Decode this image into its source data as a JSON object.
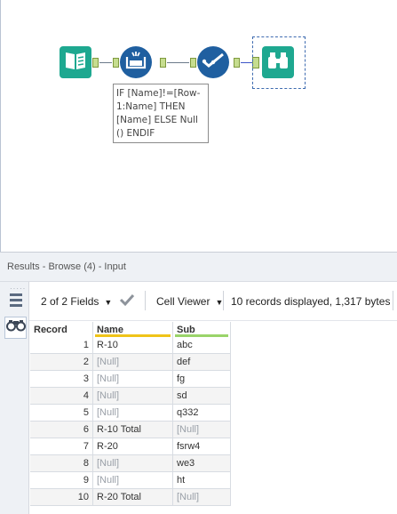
{
  "workflow": {
    "annotation": "IF [Name]!=[Row-\n1:Name] THEN\n[Name] ELSE Null\n() ENDIF",
    "tools": [
      {
        "name": "input-tool",
        "icon": "book-icon",
        "color": "#1ea890"
      },
      {
        "name": "multi-row-formula-tool",
        "icon": "formula-icon",
        "color": "#1f5fa0"
      },
      {
        "name": "select-tool",
        "icon": "checkmark-icon",
        "color": "#1f5fa0"
      },
      {
        "name": "browse-tool",
        "icon": "binoculars-icon",
        "color": "#1ea890"
      }
    ]
  },
  "results": {
    "title": "Results - Browse (4) - Input",
    "toolbar": {
      "fields_label": "2 of 2 Fields",
      "viewer_label": "Cell Viewer",
      "records_info": "10 records displayed, 1,317 bytes"
    },
    "columns": [
      "Record",
      "Name",
      "Sub"
    ],
    "rows": [
      {
        "record": "1",
        "name": "R-10",
        "sub": "abc",
        "name_null": false,
        "sub_null": false
      },
      {
        "record": "2",
        "name": "[Null]",
        "sub": "def",
        "name_null": true,
        "sub_null": false
      },
      {
        "record": "3",
        "name": "[Null]",
        "sub": "fg",
        "name_null": true,
        "sub_null": false
      },
      {
        "record": "4",
        "name": "[Null]",
        "sub": "sd",
        "name_null": true,
        "sub_null": false
      },
      {
        "record": "5",
        "name": "[Null]",
        "sub": "q332",
        "name_null": true,
        "sub_null": false
      },
      {
        "record": "6",
        "name": "R-10 Total",
        "sub": "[Null]",
        "name_null": false,
        "sub_null": true
      },
      {
        "record": "7",
        "name": "R-20",
        "sub": "fsrw4",
        "name_null": false,
        "sub_null": false
      },
      {
        "record": "8",
        "name": "[Null]",
        "sub": "we3",
        "name_null": true,
        "sub_null": false
      },
      {
        "record": "9",
        "name": "[Null]",
        "sub": "ht",
        "name_null": true,
        "sub_null": false
      },
      {
        "record": "10",
        "name": "R-20 Total",
        "sub": "[Null]",
        "name_null": false,
        "sub_null": true
      }
    ]
  },
  "colors": {
    "accent_teal": "#1ea890",
    "accent_blue": "#1f5fa0",
    "name_underline": "#f0c419",
    "sub_underline": "#9ad46a"
  }
}
